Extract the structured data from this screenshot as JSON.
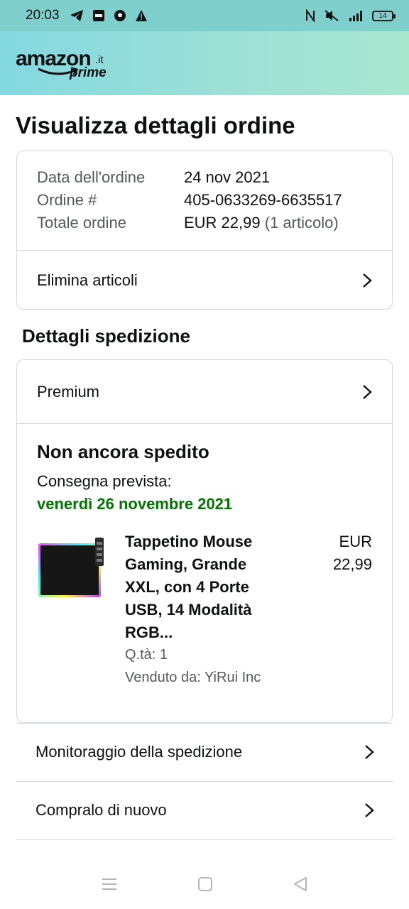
{
  "status_bar": {
    "time": "20:03",
    "left_icons": [
      "telegram-icon",
      "news-icon",
      "soccer-ball-icon",
      "warning-icon"
    ],
    "right_icons": [
      "nfc-icon",
      "mute-icon",
      "signal-icon"
    ],
    "battery": "14"
  },
  "header": {
    "logo_word": "amazon",
    "logo_domain": ".it",
    "logo_sub": "prime"
  },
  "page": {
    "title": "Visualizza dettagli ordine"
  },
  "order_summary": {
    "date_label": "Data dell'ordine",
    "date_value": "24 nov 2021",
    "number_label": "Ordine #",
    "number_value": "405-0633269-6635517",
    "total_label": "Totale ordine",
    "total_value": "EUR 22,99",
    "total_count": "(1 articolo)",
    "delete_items": "Elimina articoli"
  },
  "shipping": {
    "section_title": "Dettagli spedizione",
    "method": "Premium",
    "status": "Non ancora spedito",
    "delivery_label": "Consegna prevista:",
    "delivery_date": "venerdì 26 novembre 2021",
    "item": {
      "name": "Tappetino Mouse Gaming, Grande XXL, con 4 Porte USB, 14 Modalità RGB...",
      "price_currency": "EUR",
      "price_value": "22,99",
      "quantity": "Q.tà: 1",
      "seller": "Venduto da: YiRui Inc"
    }
  },
  "actions": {
    "track": "Monitoraggio della spedizione",
    "buy_again": "Compralo di nuovo"
  },
  "colors": {
    "header_gradient_start": "#84d8e0",
    "header_gradient_end": "#a8e6cf",
    "delivery_green": "#007600",
    "border": "#d5d9d9"
  }
}
